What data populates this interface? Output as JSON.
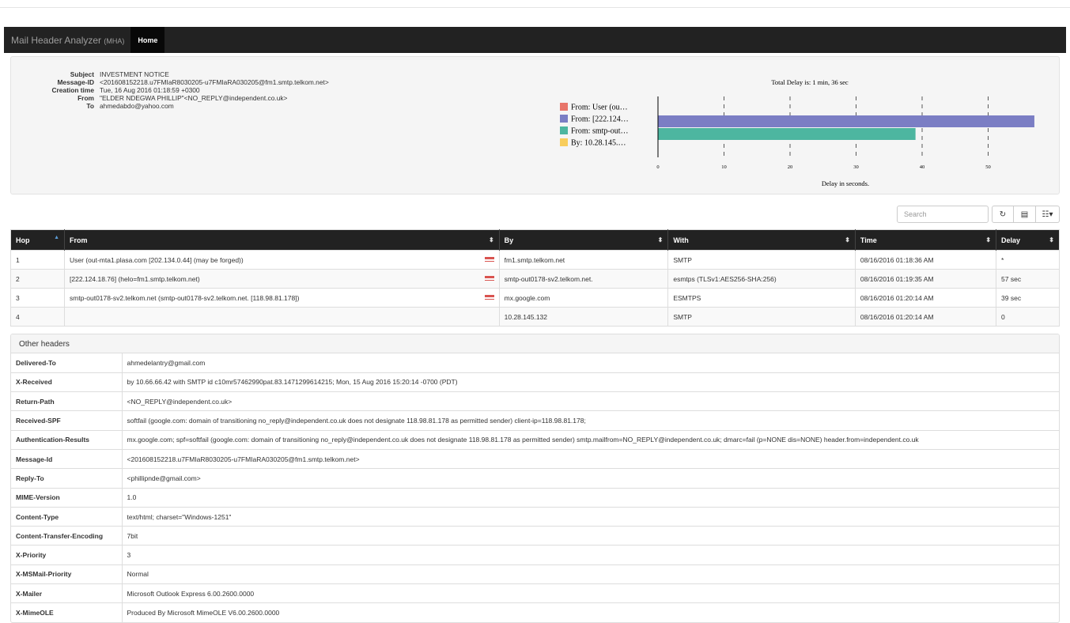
{
  "navbar": {
    "brand": "Mail Header Analyzer",
    "brand_sub": "(MHA)",
    "home": "Home"
  },
  "summary": [
    {
      "key": "Subject",
      "value": "INVESTMENT NOTICE"
    },
    {
      "key": "Message-ID",
      "value": "<201608152218.u7FMIaR8030205-u7FMIaRA030205@fm1.smtp.telkom.net>"
    },
    {
      "key": "Creation time",
      "value": "Tue, 16 Aug 2016 01:18:59 +0300"
    },
    {
      "key": "From",
      "value": "\"ELDER NDEGWA PHILLIP\"<NO_REPLY@independent.co.uk>"
    },
    {
      "key": "To",
      "value": "ahmedabdo@yahoo.com"
    }
  ],
  "chart_data": {
    "type": "bar",
    "orientation": "horizontal",
    "title": "Total Delay is: 1 min, 36 sec",
    "xlabel": "Delay in seconds.",
    "ylabel": "",
    "xlim": [
      0,
      57
    ],
    "xticks": [
      0,
      10,
      20,
      30,
      40,
      50
    ],
    "grid": "vertical-dashed",
    "legend_position": "left",
    "categories": [
      "From: User (ou…",
      "From: [222.124…",
      "From: smtp-out…",
      "By: 10.28.145.…"
    ],
    "values": [
      0,
      57,
      39,
      0
    ],
    "colors": [
      "#e8756a",
      "#7b7ec4",
      "#4db6a0",
      "#f8cd5c"
    ]
  },
  "toolbar": {
    "search_placeholder": "Search",
    "refresh_icon": "refresh-icon",
    "toggle_icon": "toggle-view-icon",
    "columns_icon": "columns-icon"
  },
  "hops": {
    "headers": [
      "Hop",
      "From",
      "By",
      "With",
      "Time",
      "Delay"
    ],
    "rows": [
      {
        "hop": "1",
        "from": "User (out-mta1.plasa.com [202.134.0.44] (may be forged))",
        "flag": true,
        "by": "fm1.smtp.telkom.net",
        "with": "SMTP",
        "time": "08/16/2016 01:18:36 AM",
        "delay": "*"
      },
      {
        "hop": "2",
        "from": "[222.124.18.76] (helo=fm1.smtp.telkom.net)",
        "flag": true,
        "by": "smtp-out0178-sv2.telkom.net.",
        "with": "esmtps (TLSv1:AES256-SHA:256)",
        "time": "08/16/2016 01:19:35 AM",
        "delay": "57 sec"
      },
      {
        "hop": "3",
        "from": "smtp-out0178-sv2.telkom.net (smtp-out0178-sv2.telkom.net. [118.98.81.178])",
        "flag": true,
        "by": "mx.google.com",
        "with": "ESMTPS",
        "time": "08/16/2016 01:20:14 AM",
        "delay": "39 sec"
      },
      {
        "hop": "4",
        "from": "",
        "flag": false,
        "by": "10.28.145.132",
        "with": "SMTP",
        "time": "08/16/2016 01:20:14 AM",
        "delay": "0"
      }
    ]
  },
  "other_headers": {
    "title": "Other headers",
    "rows": [
      {
        "key": "Delivered-To",
        "value": "ahmedelantry@gmail.com"
      },
      {
        "key": "X-Received",
        "value": "by 10.66.66.42 with SMTP id c10mr57462990pat.83.1471299614215; Mon, 15 Aug 2016 15:20:14 -0700 (PDT)"
      },
      {
        "key": "Return-Path",
        "value": "<NO_REPLY@independent.co.uk>"
      },
      {
        "key": "Received-SPF",
        "value": "softfail (google.com: domain of transitioning no_reply@independent.co.uk does not designate 118.98.81.178 as permitted sender) client-ip=118.98.81.178;"
      },
      {
        "key": "Authentication-Results",
        "value": "mx.google.com; spf=softfail (google.com: domain of transitioning no_reply@independent.co.uk does not designate 118.98.81.178 as permitted sender) smtp.mailfrom=NO_REPLY@independent.co.uk; dmarc=fail (p=NONE dis=NONE) header.from=independent.co.uk"
      },
      {
        "key": "Message-Id",
        "value": "<201608152218.u7FMIaR8030205-u7FMIaRA030205@fm1.smtp.telkom.net>"
      },
      {
        "key": "Reply-To",
        "value": "<phillipnde@gmail.com>"
      },
      {
        "key": "MIME-Version",
        "value": "1.0"
      },
      {
        "key": "Content-Type",
        "value": "text/html; charset=\"Windows-1251\""
      },
      {
        "key": "Content-Transfer-Encoding",
        "value": "7bit"
      },
      {
        "key": "X-Priority",
        "value": "3"
      },
      {
        "key": "X-MSMail-Priority",
        "value": "Normal"
      },
      {
        "key": "X-Mailer",
        "value": "Microsoft Outlook Express 6.00.2600.0000"
      },
      {
        "key": "X-MimeOLE",
        "value": "Produced By Microsoft MimeOLE V6.00.2600.0000"
      }
    ]
  }
}
